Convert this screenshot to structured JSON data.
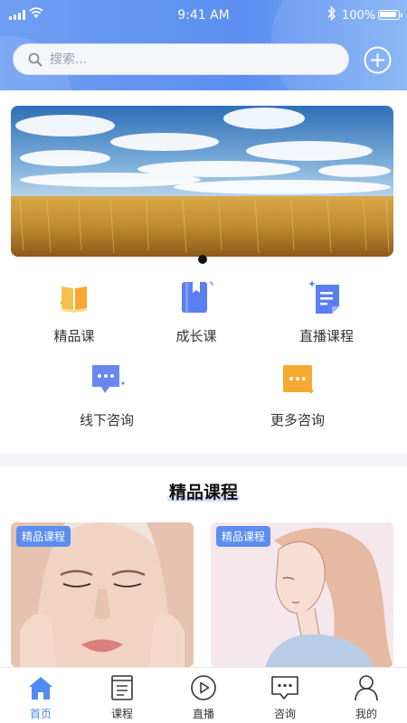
{
  "status_bar": {
    "time": "9:41 AM",
    "battery": "100%"
  },
  "search": {
    "placeholder": "搜索..."
  },
  "quick_menu": {
    "row1": [
      "精品课",
      "成长课",
      "直播课程"
    ],
    "row2": [
      "线下咨询",
      "更多咨询"
    ]
  },
  "section": {
    "title": "精品课程"
  },
  "cards": [
    {
      "tag": "精品课程"
    },
    {
      "tag": "精品课程"
    }
  ],
  "tabs": [
    "首页",
    "课程",
    "直播",
    "咨询",
    "我的"
  ],
  "colors": {
    "accent": "#4f8bf0",
    "header": "#5b8ef0",
    "tag_bg": "#5b8ef0"
  }
}
